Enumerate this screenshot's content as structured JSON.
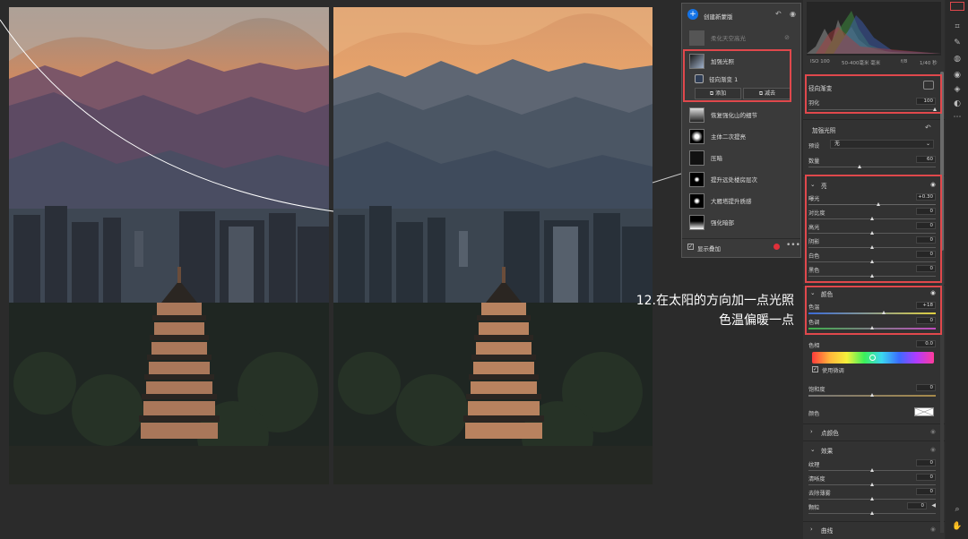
{
  "layers": {
    "create_label": "创建新蒙版",
    "items": [
      {
        "name": "柔化天空高光",
        "dim": true
      },
      {
        "name": "加强光照"
      },
      {
        "name": "径向渐变 1",
        "sub": true
      },
      {
        "name": "恢复强化山的细节"
      },
      {
        "name": "主体二次提亮"
      },
      {
        "name": "压暗"
      },
      {
        "name": "提升远处楼房层次"
      },
      {
        "name": "大雁塔提升质感"
      },
      {
        "name": "强化暗部"
      }
    ],
    "add_label": "添加",
    "subtract_label": "减去",
    "show_overlay_label": "显示叠加"
  },
  "histogram": {
    "iso": "ISO 100",
    "lens": "50-400毫米 毫米",
    "fstop": "f/8",
    "shutter": "1/40 秒"
  },
  "radial": {
    "title": "径向渐变",
    "feather_label": "羽化",
    "feather_value": "100"
  },
  "mask": {
    "title": "加强光照",
    "preset_label": "预设",
    "preset_value": "无",
    "amount_label": "数量",
    "amount_value": "60"
  },
  "light": {
    "title": "亮",
    "rows": [
      {
        "label": "曝光",
        "value": "+0.30",
        "pos": 0.55
      },
      {
        "label": "对比度",
        "value": "0",
        "pos": 0.5
      },
      {
        "label": "高光",
        "value": "0",
        "pos": 0.5
      },
      {
        "label": "阴影",
        "value": "0",
        "pos": 0.5
      },
      {
        "label": "白色",
        "value": "0",
        "pos": 0.5
      },
      {
        "label": "黑色",
        "value": "0",
        "pos": 0.5
      }
    ]
  },
  "color": {
    "title": "颜色",
    "rows": [
      {
        "label": "色温",
        "value": "+18",
        "pos": 0.59
      },
      {
        "label": "色调",
        "value": "0",
        "pos": 0.5
      }
    ],
    "hue_label": "色相",
    "hue_value": "0.0",
    "use_fine_label": "使用微调",
    "saturation_label": "饱和度",
    "saturation_value": "0",
    "tint_label": "颜色"
  },
  "point_color": {
    "title": "点颜色"
  },
  "effects": {
    "title": "效果",
    "rows": [
      {
        "label": "纹理",
        "value": "0",
        "pos": 0.5
      },
      {
        "label": "清晰度",
        "value": "0",
        "pos": 0.5
      },
      {
        "label": "去除薄雾",
        "value": "0",
        "pos": 0.5
      },
      {
        "label": "颗粒",
        "value": "0",
        "pos": 0.5
      }
    ]
  },
  "curve": {
    "title": "曲线"
  },
  "caption": {
    "line1": "12.在太阳的方向加一点光照",
    "line2": "色温偏暖一点"
  },
  "colors": {
    "accent": "#1473e6",
    "highlight": "#e0484c"
  }
}
